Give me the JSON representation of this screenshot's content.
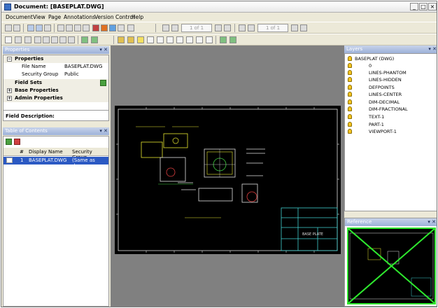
{
  "window": {
    "title": "Document: [BASEPLAT.DWG]"
  },
  "menu": [
    "Document",
    "View",
    "Page",
    "Annotations",
    "Version Control",
    "Help"
  ],
  "toolbar": {
    "page_display_1": "1 of 1",
    "page_display_2": "1 of 1"
  },
  "properties_pane": {
    "title": "Properties",
    "groups": [
      {
        "label": "Properties",
        "expanded": true,
        "rows": [
          {
            "key": "File Name",
            "value": "BASEPLAT.DWG"
          },
          {
            "key": "Security Group",
            "value": "Public"
          }
        ]
      },
      {
        "label": "Field Sets",
        "expanded": false
      },
      {
        "label": "Base Properties",
        "expanded": false
      },
      {
        "label": "Admin Properties",
        "expanded": false
      }
    ],
    "field_description_label": "Field Description:"
  },
  "toc_pane": {
    "title": "Table of Contents",
    "columns": [
      "#",
      "Display Name",
      "Security Group"
    ],
    "rows": [
      {
        "num": "1",
        "name": "BASEPLAT.DWG",
        "security": "(Same as docu..."
      }
    ]
  },
  "layers_pane": {
    "title": "Layers",
    "root": "BASEPLAT (DWG)",
    "layers": [
      "0",
      "LINES-PHANTOM",
      "LINES-HIDDEN",
      "DEFPOINTS",
      "LINES-CENTER",
      "DIM-DECIMAL",
      "DIM-FRACTIONAL",
      "TEXT-1",
      "PART-1",
      "VIEWPORT-1"
    ]
  },
  "reference_pane": {
    "title": "Reference"
  },
  "drawing": {
    "title_block": "BASE PLATE"
  },
  "colors": {
    "accent": "#2b59c3",
    "pane_title": "#9db1d9",
    "drawing_bg": "#000000",
    "bulb": "#f6c520"
  }
}
